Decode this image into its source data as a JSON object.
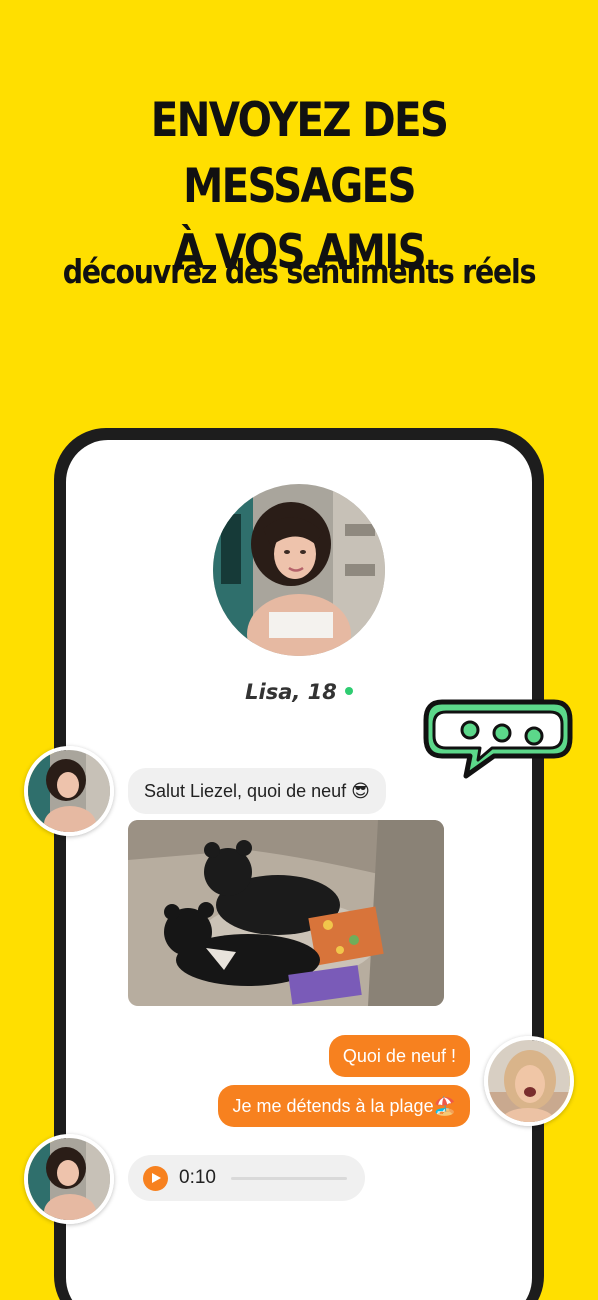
{
  "promo": {
    "headline_line1": "ENVOYEZ DES MESSAGES",
    "headline_line2": "À VOS AMIS",
    "subtitle": "découvrez des sentiments réels"
  },
  "profile": {
    "name_age": "Lisa, 18",
    "online": true
  },
  "chat": {
    "messages": [
      {
        "from": "contact",
        "type": "text",
        "text": "Salut Liezel, quoi de neuf 😎"
      },
      {
        "from": "contact",
        "type": "gif",
        "content": "bears-relaxing-gif"
      },
      {
        "from": "me",
        "type": "text",
        "text": "Quoi de neuf !"
      },
      {
        "from": "me",
        "type": "text",
        "text": "Je me détends à la plage🏖️"
      },
      {
        "from": "contact",
        "type": "voice",
        "duration": "0:10"
      }
    ]
  },
  "icons": {
    "typing": "typing-indicator-icon",
    "play": "play-icon",
    "online": "online-dot-icon"
  },
  "colors": {
    "background": "#FFDF00",
    "accent_orange": "#F7811F",
    "online_green": "#2ecc71",
    "typing_green": "#5CD88A",
    "incoming_bubble": "#f0f0f0"
  }
}
